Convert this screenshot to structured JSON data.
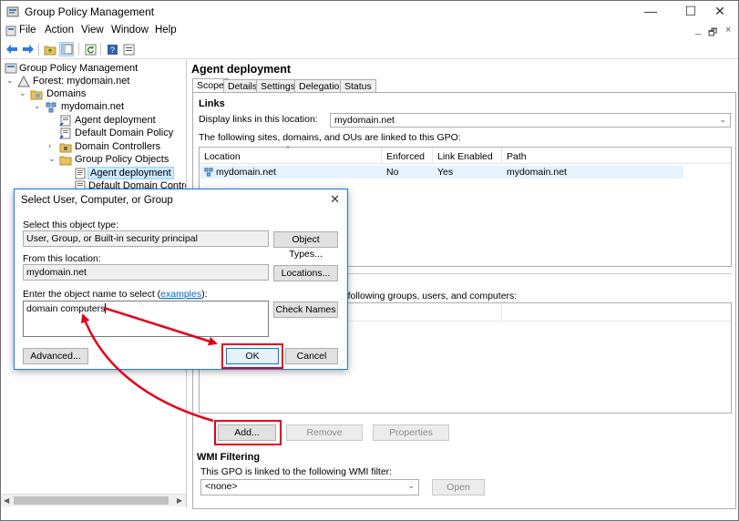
{
  "window": {
    "title": "Group Policy Management",
    "controls": {
      "minimize": "—",
      "maximize": "☐",
      "close": "✕"
    }
  },
  "menu": {
    "items": [
      "File",
      "Action",
      "View",
      "Window",
      "Help"
    ],
    "right_minimize": "_",
    "right_restore": "🗗",
    "right_close": "×"
  },
  "toolbar": {
    "icons": [
      "back-icon",
      "forward-icon",
      "folder-up-icon",
      "console-tree-icon",
      "refresh-icon",
      "help-icon",
      "properties-icon"
    ]
  },
  "tree": {
    "items": [
      {
        "label": "Group Policy Management",
        "icon": "gpm-icon",
        "twisty": ""
      },
      {
        "label": "Forest: mydomain.net",
        "icon": "forest-icon",
        "twisty": "⌄"
      },
      {
        "label": "Domains",
        "icon": "domains-icon",
        "twisty": "⌄"
      },
      {
        "label": "mydomain.net",
        "icon": "domain-icon",
        "twisty": "⌄"
      },
      {
        "label": "Agent deployment",
        "icon": "gpo-link-icon",
        "twisty": ""
      },
      {
        "label": "Default Domain Policy",
        "icon": "gpo-link-icon",
        "twisty": ""
      },
      {
        "label": "Domain Controllers",
        "icon": "ou-icon",
        "twisty": "›"
      },
      {
        "label": "Group Policy Objects",
        "icon": "folder-icon",
        "twisty": "⌄"
      },
      {
        "label": "Agent deployment",
        "icon": "gpo-icon",
        "twisty": ""
      },
      {
        "label": "Default Domain Controll",
        "icon": "gpo-icon",
        "twisty": ""
      }
    ]
  },
  "gpo": {
    "title": "Agent deployment",
    "tabs": [
      "Scope",
      "Details",
      "Settings",
      "Delegation",
      "Status"
    ],
    "links": {
      "heading": "Links",
      "display_label": "Display links in this location:",
      "location_value": "mydomain.net",
      "linked_label": "The following sites, domains, and OUs are linked to this GPO:",
      "columns": [
        "Location",
        "Enforced",
        "Link Enabled",
        "Path"
      ],
      "rows": [
        {
          "location": "mydomain.net",
          "enforced": "No",
          "link_enabled": "Yes",
          "path": "mydomain.net"
        }
      ]
    },
    "security": {
      "label_fragment": "he following groups, users, and computers:",
      "add": "Add...",
      "remove": "Remove",
      "properties": "Properties"
    },
    "wmi": {
      "heading": "WMI Filtering",
      "label": "This GPO is linked to the following WMI filter:",
      "value": "<none>",
      "open": "Open"
    }
  },
  "dialog": {
    "title": "Select User, Computer, or Group",
    "close": "✕",
    "object_type_label": "Select this object type:",
    "object_type_value": "User, Group, or Built-in security principal",
    "object_types_button": "Object Types...",
    "location_label": "From this location:",
    "location_value": "mydomain.net",
    "locations_button": "Locations...",
    "enter_label_prefix": "Enter the object name to select (",
    "enter_label_link": "examples",
    "enter_label_suffix": "):",
    "object_name_value": "domain computers",
    "check_names_button": "Check Names",
    "advanced_button": "Advanced...",
    "ok_button": "OK",
    "cancel_button": "Cancel"
  },
  "colors": {
    "annotation": "#e3001b",
    "selection": "#cce8ff",
    "link": "#0066cc"
  }
}
